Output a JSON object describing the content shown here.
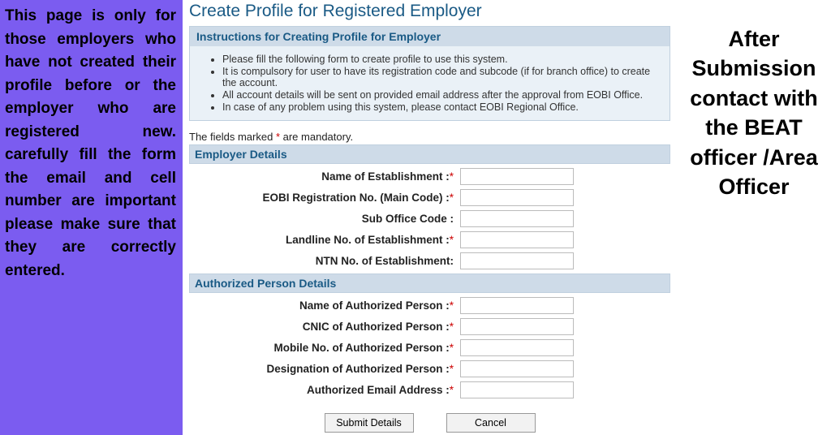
{
  "left_note": "This page is only for those employers who have not created their profile before or the employer who are registered new. carefully fill the form the email and cell number are important please make sure that they are correctly entered.",
  "right_note": "After Submission contact with the BEAT officer /Area Officer",
  "page_title": "Create Profile for Registered Employer",
  "instructions": {
    "header": "Instructions for Creating Profile for Employer",
    "items": [
      "Please fill the following form to create profile to use this system.",
      "It is compulsory for user to have its registration code and subcode (if for branch office) to create the account.",
      "All account details will be sent on provided email address after the approval from EOBI Office.",
      "In case of any problem using this system, please contact EOBI Regional Office."
    ]
  },
  "mandatory_prefix": "The fields marked",
  "mandatory_star": " * ",
  "mandatory_suffix": "are mandatory.",
  "sections": {
    "employer": "Employer Details",
    "authorized": "Authorized Person Details"
  },
  "fields": {
    "establishment_name": {
      "label": "Name of Establishment :",
      "req": "*",
      "value": ""
    },
    "eobi_reg": {
      "label": "EOBI Registration No. (Main Code) :",
      "req": "*",
      "value": ""
    },
    "sub_office": {
      "label": "Sub Office Code :",
      "req": "",
      "value": ""
    },
    "landline": {
      "label": "Landline No. of Establishment :",
      "req": "*",
      "value": ""
    },
    "ntn": {
      "label": "NTN No. of Establishment:",
      "req": "",
      "value": ""
    },
    "auth_name": {
      "label": "Name of Authorized Person :",
      "req": "*",
      "value": ""
    },
    "auth_cnic": {
      "label": "CNIC of Authorized Person :",
      "req": "*",
      "value": ""
    },
    "auth_mobile": {
      "label": "Mobile No. of Authorized Person :",
      "req": "*",
      "value": ""
    },
    "auth_designation": {
      "label": "Designation of Authorized Person :",
      "req": "*",
      "value": ""
    },
    "auth_email": {
      "label": "Authorized Email Address :",
      "req": "*",
      "value": ""
    }
  },
  "buttons": {
    "submit": "Submit Details",
    "cancel": "Cancel"
  }
}
